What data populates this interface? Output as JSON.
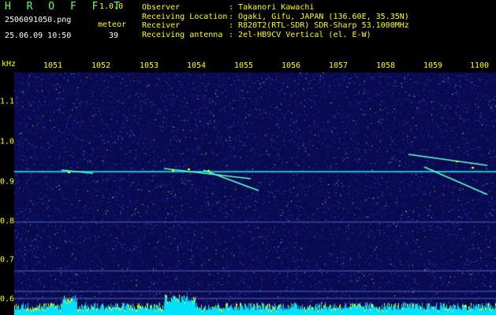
{
  "header": {
    "app_title": "H R O F F T",
    "app_version": "1.0.0",
    "filename": "2506091050.png",
    "timestamp": "25.06.09 10:50",
    "meteor_label": "meteor",
    "meteor_count": "39",
    "info": [
      {
        "key": "Observer",
        "sep": ": ",
        "value": "Takanori Kawachi"
      },
      {
        "key": "Receiving Location",
        "sep": ": ",
        "value": "Ogaki, Gifu, JAPAN (136.60E, 35.35N)"
      },
      {
        "key": "Receiver",
        "sep": ": ",
        "value": "R820T2(RTL-SDR) SDR-Sharp 53.1000MHz"
      },
      {
        "key": "Receiving antenna",
        "sep": ": ",
        "value": "2el-HB9CV Vertical (el. E-W)"
      }
    ]
  },
  "axis": {
    "khz_label": "kHz",
    "time_labels": [
      "1051",
      "1052",
      "1053",
      "1054",
      "1055",
      "1056",
      "1057",
      "1058",
      "1059",
      "1100"
    ],
    "freq_labels": [
      "1.1",
      "1.0",
      "0.9",
      "0.8",
      "0.7",
      "0.6"
    ]
  },
  "colors": {
    "background": "#000000",
    "spectrum_bg": "#0a0a50",
    "text_yellow": "#ffff00",
    "title_green": "#66ff66",
    "signal_cyan": "#00ffff",
    "signal_yellow": "#ffff00"
  }
}
